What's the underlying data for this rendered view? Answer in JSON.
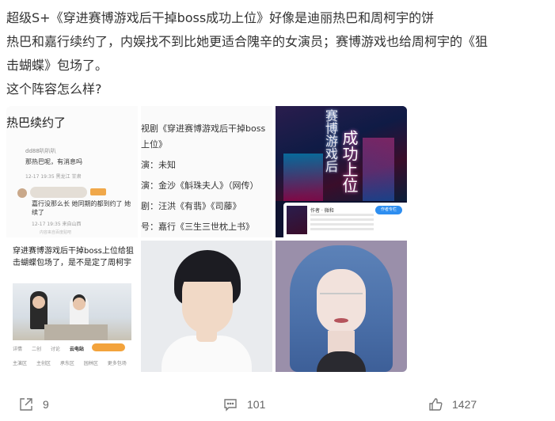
{
  "post": {
    "lines": [
      "超级S+《穿进赛博游戏后干掉boss成功上位》好像是迪丽热巴和周柯宇的饼",
      "热巴和嘉行续约了，内娱找不到比她更适合隗辛的女演员；赛博游戏也给周柯宇的《狙",
      "击蝴蝶》包场了。",
      "这个阵容怎么样?"
    ]
  },
  "images": {
    "forum": {
      "title": "热巴续约了",
      "user": "dd88叭叭叭",
      "msg": "那热巴呢，有消息吗",
      "meta": "12-17 19:35  黑龙江  甘肃",
      "reply": "嘉行没那么长 她同期的都到约了 她续了",
      "reply_meta": "12-17 19:35  来自山西",
      "footer": "内容来自百度贴吧"
    },
    "casting": {
      "lines": [
        "视剧《穿进赛博游戏后干掉boss",
        "上位》",
        "演：未知",
        "演：金沙《斛珠夫人》（网传）",
        "剧：汪洪《有翡》《司藤》",
        "号：嘉行《三生三世枕上书》"
      ]
    },
    "cover": {
      "title_a": "赛博游戏后",
      "title_b": "成功上位",
      "info_title": "作者 · 微和",
      "info_btn": "作者专栏"
    },
    "app": {
      "title": "穿进赛博游戏后干掉boss上位给狙击蝴蝶包场了，是不是定了周柯宇",
      "tabs": [
        "详情",
        "二创",
        "讨论",
        "云电站"
      ],
      "subtabs": [
        "主演区",
        "主创区",
        "承东区",
        "园林区",
        "更多包场"
      ]
    },
    "portrait_male": {
      "icon": "portrait-photo"
    },
    "portrait_female": {
      "icon": "portrait-photo"
    }
  },
  "actions": {
    "share_count": "9",
    "comment_count": "101",
    "like_count": "1427"
  }
}
